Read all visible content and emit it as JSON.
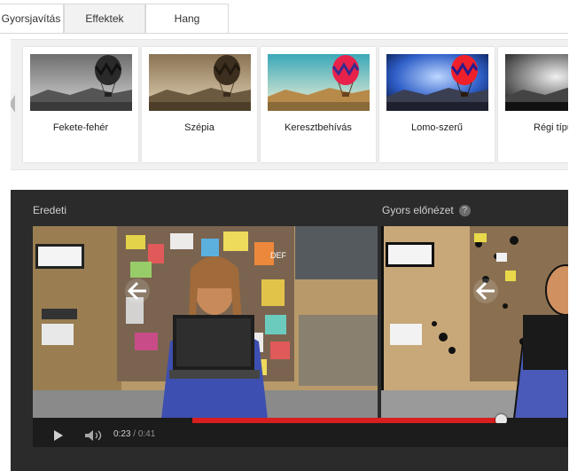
{
  "tabs": [
    {
      "label": "Gyorsjavítás",
      "active": false
    },
    {
      "label": "Effektek",
      "active": true
    },
    {
      "label": "Hang",
      "active": false
    }
  ],
  "effects": [
    {
      "label": "Fekete-fehér"
    },
    {
      "label": "Szépia"
    },
    {
      "label": "Keresztbehívás"
    },
    {
      "label": "Lomo-szerű"
    },
    {
      "label": "Régi típu"
    }
  ],
  "player": {
    "original_label": "Eredeti",
    "preview_label": "Gyors előnézet",
    "help_glyph": "?",
    "current_time": "0:23",
    "separator": " / ",
    "total_time": "0:41",
    "progress_fraction": 0.56
  },
  "colors": {
    "progress_played": "#d81e1e",
    "player_bg": "#2b2b2b"
  },
  "icons": [
    "chevron-left-icon",
    "play-icon",
    "volume-icon",
    "help-icon",
    "back-arrow-icon"
  ]
}
